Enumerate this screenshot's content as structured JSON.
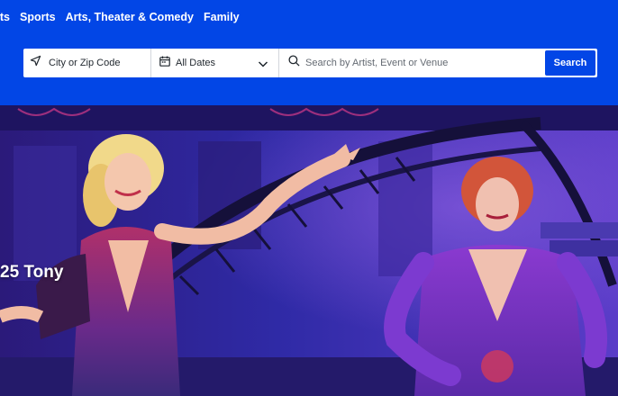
{
  "nav": {
    "items": [
      "rts",
      "Sports",
      "Arts, Theater & Comedy",
      "Family"
    ]
  },
  "search": {
    "location_label": "City or Zip Code",
    "dates_label": "All Dates",
    "query_placeholder": "Search by Artist, Event or Venue",
    "button_label": "Search"
  },
  "hero": {
    "title": "25 Tony"
  },
  "colors": {
    "brand": "#0246e6",
    "white": "#ffffff"
  }
}
